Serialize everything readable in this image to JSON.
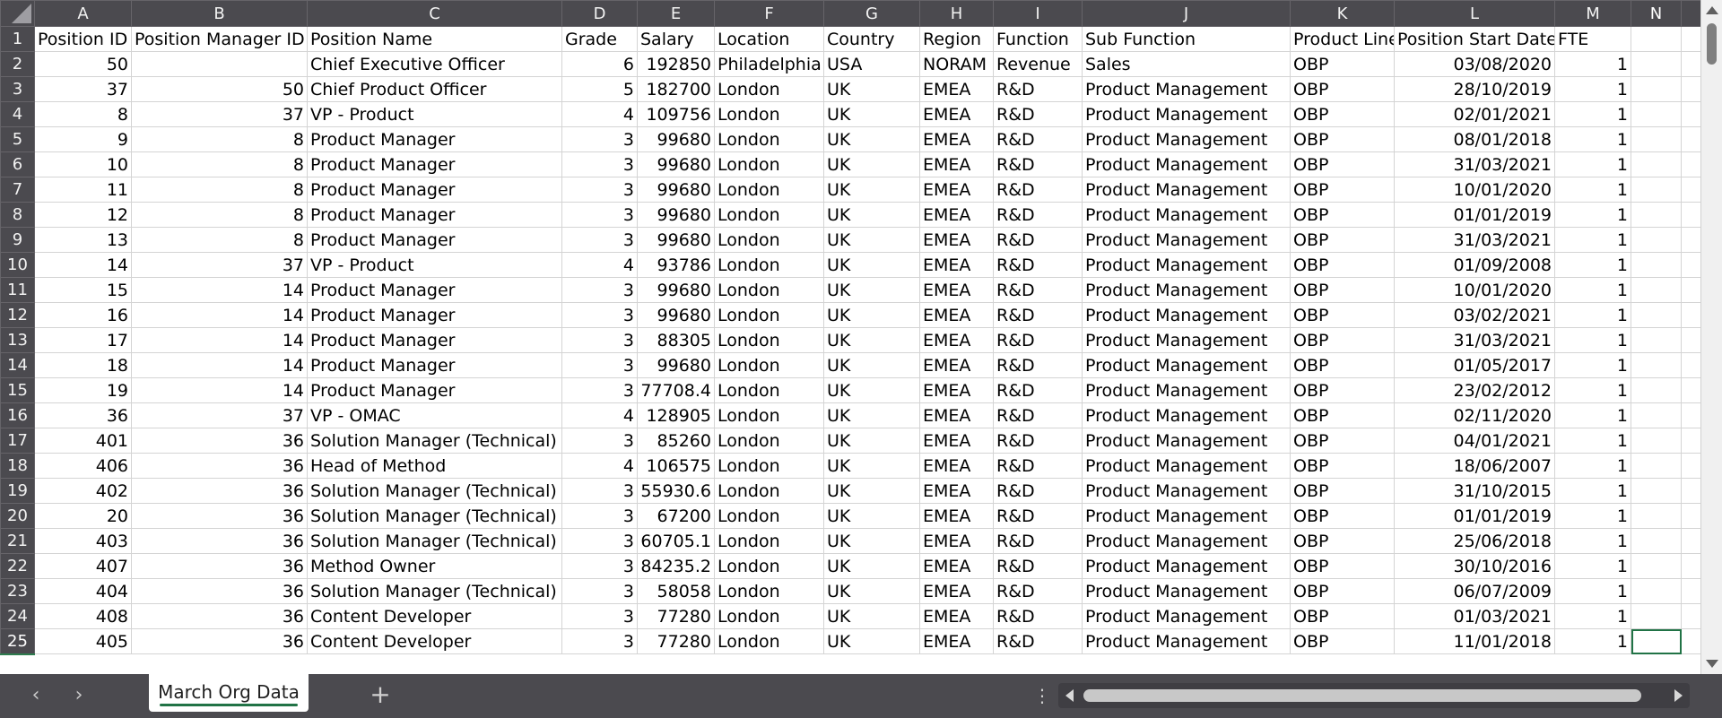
{
  "columns": [
    "A",
    "B",
    "C",
    "D",
    "E",
    "F",
    "G",
    "H",
    "I",
    "J",
    "K",
    "L",
    "M",
    "N"
  ],
  "selected_column": "N",
  "selected_row": 25,
  "header_row": [
    "Position ID",
    "Position Manager ID",
    "Position Name",
    "Grade",
    "Salary",
    "Location",
    "Country",
    "Region",
    "Function",
    "Sub Function",
    "Product Line",
    "Position Start Date",
    "FTE",
    ""
  ],
  "rows": [
    [
      50,
      "",
      "Chief Executive Officer",
      6,
      192850,
      "Philadelphia",
      "USA",
      "NORAM",
      "Revenue",
      "Sales",
      "OBP",
      "03/08/2020",
      1
    ],
    [
      37,
      50,
      "Chief Product Officer",
      5,
      182700,
      "London",
      "UK",
      "EMEA",
      "R&D",
      "Product Management",
      "OBP",
      "28/10/2019",
      1
    ],
    [
      8,
      37,
      "VP - Product",
      4,
      109756,
      "London",
      "UK",
      "EMEA",
      "R&D",
      "Product Management",
      "OBP",
      "02/01/2021",
      1
    ],
    [
      9,
      8,
      "Product Manager",
      3,
      99680,
      "London",
      "UK",
      "EMEA",
      "R&D",
      "Product Management",
      "OBP",
      "08/01/2018",
      1
    ],
    [
      10,
      8,
      "Product Manager",
      3,
      99680,
      "London",
      "UK",
      "EMEA",
      "R&D",
      "Product Management",
      "OBP",
      "31/03/2021",
      1
    ],
    [
      11,
      8,
      "Product Manager",
      3,
      99680,
      "London",
      "UK",
      "EMEA",
      "R&D",
      "Product Management",
      "OBP",
      "10/01/2020",
      1
    ],
    [
      12,
      8,
      "Product Manager",
      3,
      99680,
      "London",
      "UK",
      "EMEA",
      "R&D",
      "Product Management",
      "OBP",
      "01/01/2019",
      1
    ],
    [
      13,
      8,
      "Product Manager",
      3,
      99680,
      "London",
      "UK",
      "EMEA",
      "R&D",
      "Product Management",
      "OBP",
      "31/03/2021",
      1
    ],
    [
      14,
      37,
      "VP - Product",
      4,
      93786,
      "London",
      "UK",
      "EMEA",
      "R&D",
      "Product Management",
      "OBP",
      "01/09/2008",
      1
    ],
    [
      15,
      14,
      "Product Manager",
      3,
      99680,
      "London",
      "UK",
      "EMEA",
      "R&D",
      "Product Management",
      "OBP",
      "10/01/2020",
      1
    ],
    [
      16,
      14,
      "Product Manager",
      3,
      99680,
      "London",
      "UK",
      "EMEA",
      "R&D",
      "Product Management",
      "OBP",
      "03/02/2021",
      1
    ],
    [
      17,
      14,
      "Product Manager",
      3,
      88305,
      "London",
      "UK",
      "EMEA",
      "R&D",
      "Product Management",
      "OBP",
      "31/03/2021",
      1
    ],
    [
      18,
      14,
      "Product Manager",
      3,
      99680,
      "London",
      "UK",
      "EMEA",
      "R&D",
      "Product Management",
      "OBP",
      "01/05/2017",
      1
    ],
    [
      19,
      14,
      "Product Manager",
      3,
      "77708.4",
      "London",
      "UK",
      "EMEA",
      "R&D",
      "Product Management",
      "OBP",
      "23/02/2012",
      1
    ],
    [
      36,
      37,
      "VP - OMAC",
      4,
      128905,
      "London",
      "UK",
      "EMEA",
      "R&D",
      "Product Management",
      "OBP",
      "02/11/2020",
      1
    ],
    [
      401,
      36,
      "Solution Manager (Technical)",
      3,
      85260,
      "London",
      "UK",
      "EMEA",
      "R&D",
      "Product Management",
      "OBP",
      "04/01/2021",
      1
    ],
    [
      406,
      36,
      "Head of Method",
      4,
      106575,
      "London",
      "UK",
      "EMEA",
      "R&D",
      "Product Management",
      "OBP",
      "18/06/2007",
      1
    ],
    [
      402,
      36,
      "Solution Manager (Technical)",
      3,
      "55930.6",
      "London",
      "UK",
      "EMEA",
      "R&D",
      "Product Management",
      "OBP",
      "31/10/2015",
      1
    ],
    [
      20,
      36,
      "Solution Manager (Technical)",
      3,
      67200,
      "London",
      "UK",
      "EMEA",
      "R&D",
      "Product Management",
      "OBP",
      "01/01/2019",
      1
    ],
    [
      403,
      36,
      "Solution Manager (Technical)",
      3,
      "60705.1",
      "London",
      "UK",
      "EMEA",
      "R&D",
      "Product Management",
      "OBP",
      "25/06/2018",
      1
    ],
    [
      407,
      36,
      "Method Owner",
      3,
      "84235.2",
      "London",
      "UK",
      "EMEA",
      "R&D",
      "Product Management",
      "OBP",
      "30/10/2016",
      1
    ],
    [
      404,
      36,
      "Solution Manager (Technical)",
      3,
      58058,
      "London",
      "UK",
      "EMEA",
      "R&D",
      "Product Management",
      "OBP",
      "06/07/2009",
      1
    ],
    [
      408,
      36,
      "Content Developer",
      3,
      77280,
      "London",
      "UK",
      "EMEA",
      "R&D",
      "Product Management",
      "OBP",
      "01/03/2021",
      1
    ],
    [
      405,
      36,
      "Content Developer",
      3,
      77280,
      "London",
      "UK",
      "EMEA",
      "R&D",
      "Product Management",
      "OBP",
      "11/01/2018",
      1
    ]
  ],
  "sheet_tabs": [
    {
      "label": "March Org Data",
      "active": true
    }
  ],
  "tabbar": {
    "prev_icon": "‹",
    "next_icon": "›",
    "add_icon": "+",
    "options_icon": "⋮"
  },
  "colors": {
    "accent": "#217346",
    "chrome": "#4b4a4f"
  }
}
